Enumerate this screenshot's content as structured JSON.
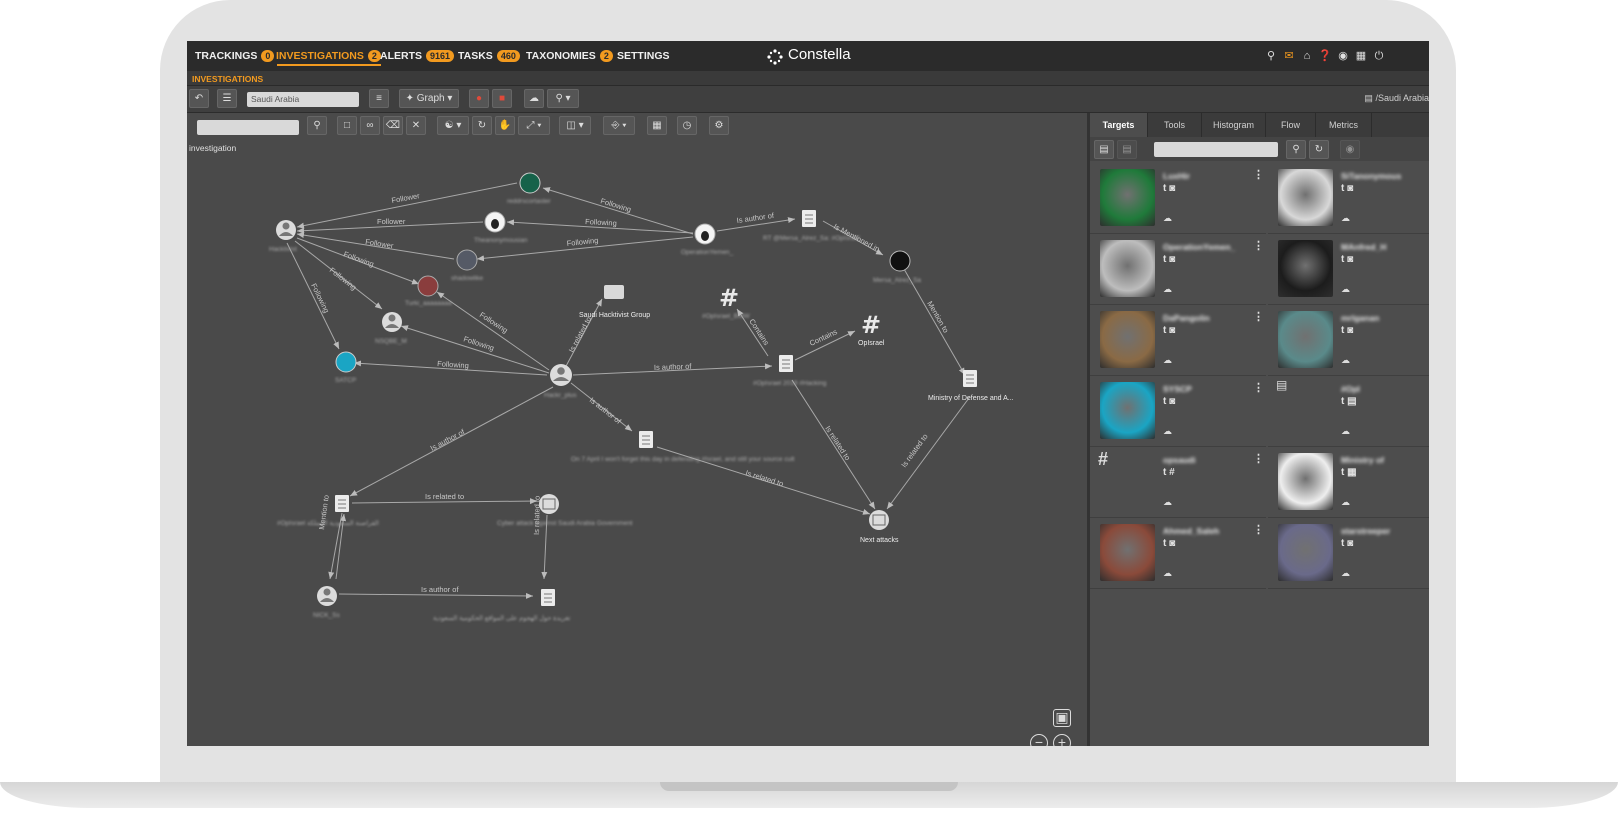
{
  "nav": {
    "items": [
      {
        "label": "TRACKINGS",
        "count": "0"
      },
      {
        "label": "INVESTIGATIONS",
        "count": "2"
      },
      {
        "label": "ALERTS",
        "count": "9161"
      },
      {
        "label": "TASKS",
        "count": "460"
      },
      {
        "label": "TAXONOMIES",
        "count": "2"
      },
      {
        "label": "SETTINGS",
        "count": ""
      }
    ],
    "logo": "Constella",
    "right_icons": [
      "search-icon",
      "mail-icon",
      "home-icon",
      "help-icon",
      "support-icon",
      "apps-icon",
      "power-icon"
    ]
  },
  "subheader": {
    "title": "INVESTIGATIONS"
  },
  "toolbar": {
    "search_value": "Saudi Arabia",
    "graph_label": "Graph",
    "path": "/Saudi Arabia"
  },
  "canvas": {
    "label": "investigation",
    "nodes": {
      "saudi_hacktivist": "Saudi Hacktivist Group",
      "opisrael": "OpIsrael",
      "ministry": "Ministry of Defense and A...",
      "next_attacks": "Next attacks"
    },
    "edge_labels": {
      "follower": "Follower",
      "following": "Following",
      "is_author_of": "Is author of",
      "is_mentioned_in": "Is Mentioned in",
      "is_related_to": "Is related to",
      "contains": "Contains",
      "mention_to": "Mention to"
    }
  },
  "right_panel": {
    "tabs": [
      "Targets",
      "Tools",
      "Histogram",
      "Flow",
      "Metrics"
    ],
    "cards": [
      {
        "name": "LuxHir",
        "icons": "t ◙",
        "color": "#1f7a3a"
      },
      {
        "name": "SiTanonymous",
        "icons": "t ◙",
        "color": "#d8d8d8"
      },
      {
        "name": "OperationYemen_",
        "icons": "t ◙",
        "color": "#bdbdbd"
      },
      {
        "name": "MAnfred_H",
        "icons": "t ◙",
        "color": "#1c1c1c"
      },
      {
        "name": "DaPangolin",
        "icons": "t ◙",
        "color": "#8a6a45"
      },
      {
        "name": "mrlganan",
        "icons": "t ◙",
        "color": "#5a8a8a"
      },
      {
        "name": "SYSCP",
        "icons": "t ◙",
        "color": "#1aa5c4"
      },
      {
        "name": "#OpI",
        "icons": "t ▤",
        "color": ""
      },
      {
        "name": "opsaudi",
        "icons": "t #",
        "color": ""
      },
      {
        "name": "Ministry of",
        "icons": "t ▦",
        "color": "#eeeeee"
      },
      {
        "name": "Ahmed_Saleh",
        "icons": "t ◙",
        "color": "#8a4a3a"
      },
      {
        "name": "starstreeper",
        "icons": "t ◙",
        "color": "#6a6a8a"
      }
    ]
  }
}
